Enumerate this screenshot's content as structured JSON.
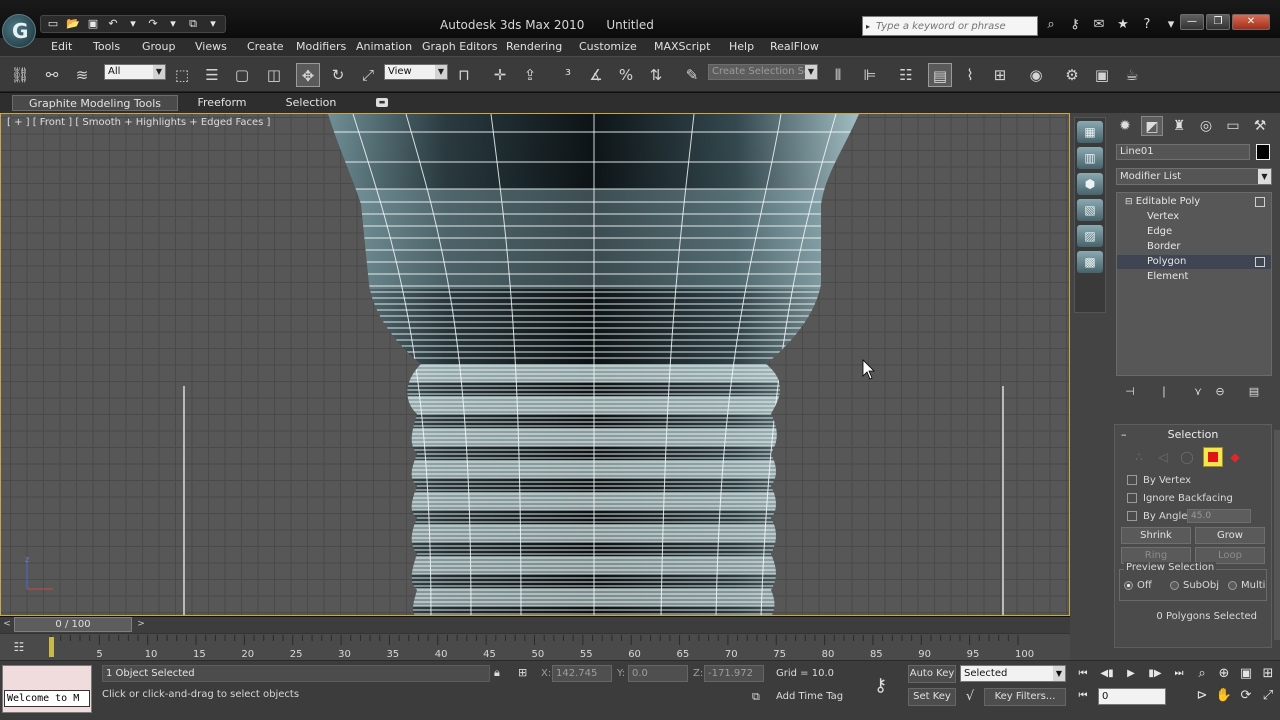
{
  "app": {
    "logo_letter": "G",
    "title": "Autodesk 3ds Max 2010",
    "document": "Untitled",
    "search_placeholder": "Type a keyword or phrase"
  },
  "menu": [
    "Edit",
    "Tools",
    "Group",
    "Views",
    "Create",
    "Modifiers",
    "Animation",
    "Graph Editors",
    "Rendering",
    "Customize",
    "MAXScript",
    "Help",
    "RealFlow"
  ],
  "toolbar": {
    "selection_filter": "All",
    "ref_coord": "View",
    "named_selection_placeholder": "Create Selection Se"
  },
  "ribbon": {
    "tabs": [
      "Graphite Modeling Tools",
      "Freeform",
      "Selection"
    ],
    "active_tab": "Graphite Modeling Tools"
  },
  "viewport": {
    "label": "[ + ] [ Front ] [ Smooth + Highlights + Edged Faces ]",
    "border_color": "#c8a84b"
  },
  "command_panel": {
    "object_name": "Line01",
    "object_color": "#000000",
    "modifier_list": "Modifier List",
    "stack": [
      {
        "label": "Editable Poly",
        "level": 0,
        "selected": false
      },
      {
        "label": "Vertex",
        "level": 1,
        "selected": false
      },
      {
        "label": "Edge",
        "level": 1,
        "selected": false
      },
      {
        "label": "Border",
        "level": 1,
        "selected": false
      },
      {
        "label": "Polygon",
        "level": 1,
        "selected": true
      },
      {
        "label": "Element",
        "level": 1,
        "selected": false
      }
    ],
    "selection_rollout": {
      "title": "Selection",
      "by_vertex": "By Vertex",
      "ignore_backfacing": "Ignore Backfacing",
      "by_angle": "By Angle:",
      "angle_value": "45.0",
      "shrink": "Shrink",
      "grow": "Grow",
      "ring": "Ring",
      "loop": "Loop",
      "preview_title": "Preview Selection",
      "preview_off": "Off",
      "preview_subobj": "SubObj",
      "preview_multi": "Multi",
      "count": "0 Polygons Selected",
      "active_level": "polygon",
      "active_color": "#f6e64a"
    }
  },
  "timeline": {
    "position": "0 / 100",
    "ticks": [
      5,
      10,
      15,
      20,
      25,
      30,
      35,
      40,
      45,
      50,
      55,
      60,
      65,
      70,
      75,
      80,
      85,
      90,
      95,
      100
    ]
  },
  "status": {
    "maxscript_output": "Welcome to M",
    "objects_selected": "1 Object Selected",
    "prompt": "Click or click-and-drag to select objects",
    "x_label": "X:",
    "x_value": "142.745",
    "y_label": "Y:",
    "y_value": "0.0",
    "z_label": "Z:",
    "z_value": "-171.972",
    "grid": "Grid = 10.0",
    "add_time_tag": "Add Time Tag",
    "auto_key": "Auto Key",
    "set_key": "Set Key",
    "key_mode": "Selected",
    "key_filters": "Key Filters...",
    "current_frame": "0"
  }
}
